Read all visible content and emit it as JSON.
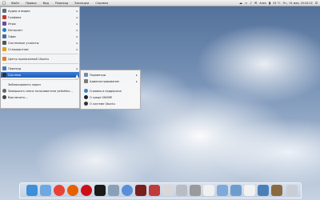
{
  "topbar": {
    "menus": [
      "Файл",
      "Правка",
      "Вид",
      "Переход",
      "Закладки",
      "Справка"
    ],
    "user": "Алек",
    "status": "25 °C",
    "datetime": "Пт., 31 мая, 20:43:22"
  },
  "main_menu": {
    "items": [
      {
        "label": "Аудио и видео",
        "icon": "audio-video-icon",
        "color": "#5b6f8a",
        "submenu": true
      },
      {
        "label": "Графика",
        "icon": "graphics-icon",
        "color": "#c0392b",
        "submenu": true
      },
      {
        "label": "Игры",
        "icon": "games-icon",
        "color": "#6b4aa0",
        "submenu": true
      },
      {
        "label": "Интернет",
        "icon": "internet-icon",
        "color": "#2b78c5",
        "submenu": true
      },
      {
        "label": "Офис",
        "icon": "office-icon",
        "color": "#3b6ea5",
        "submenu": true
      },
      {
        "label": "Системные утилиты",
        "icon": "system-tools-icon",
        "color": "#555555",
        "submenu": true
      },
      {
        "label": "Стандартные",
        "icon": "accessories-icon",
        "color": "#e0a020",
        "submenu": true
      },
      {
        "label": "Центр приложений Ubuntu",
        "icon": "ubuntu-software-center-icon",
        "color": "#d9822b",
        "submenu": false
      },
      {
        "label": "Переход",
        "icon": "places-icon",
        "color": "#4a76b8",
        "submenu": true
      },
      {
        "label": "Система",
        "icon": "system-icon",
        "color": "#333333",
        "submenu": true,
        "selected": true
      },
      {
        "label": "Заблокировать экран",
        "icon": "lock-screen-icon",
        "color": "#777777",
        "submenu": false
      },
      {
        "label": "Завершить сеанс пользователя yetishiku...",
        "icon": "logout-icon",
        "color": "#666666",
        "submenu": false
      },
      {
        "label": "Выключить...",
        "icon": "shutdown-icon",
        "color": "#444444",
        "submenu": false
      }
    ]
  },
  "submenu": {
    "items": [
      {
        "label": "Параметры",
        "icon": "preferences-icon",
        "color": "#6f8cad",
        "submenu": true
      },
      {
        "label": "Администрирование",
        "icon": "administration-icon",
        "color": "#7a7a7a",
        "submenu": true
      },
      {
        "label": "Справка и поддержка",
        "icon": "help-icon",
        "color": "#3b82c4",
        "submenu": false
      },
      {
        "label": "О среде GNOME",
        "icon": "gnome-icon",
        "color": "#222222",
        "submenu": false
      },
      {
        "label": "О системе Ubuntu",
        "icon": "apple-icon",
        "color": "#333333",
        "submenu": false
      }
    ]
  },
  "dock": {
    "items": [
      {
        "name": "finder-icon",
        "color": "#3c8fd8"
      },
      {
        "name": "app-store-icon",
        "color": "#6ea8e0"
      },
      {
        "name": "chrome-icon",
        "color": "#e94235"
      },
      {
        "name": "firefox-icon",
        "color": "#e66000"
      },
      {
        "name": "opera-icon",
        "color": "#cc0f16"
      },
      {
        "name": "terminal-icon",
        "color": "#1a1a1a"
      },
      {
        "name": "photos-icon",
        "color": "#8aa0b8"
      },
      {
        "name": "itunes-icon",
        "color": "#5a8fd8"
      },
      {
        "name": "dictionary-icon",
        "color": "#7a1e1e"
      },
      {
        "name": "photo-booth-icon",
        "color": "#c23b3b"
      },
      {
        "name": "preview-icon",
        "color": "#d8d8d8"
      },
      {
        "name": "scanner-icon",
        "color": "#b8bcc4"
      },
      {
        "name": "calculator-icon",
        "color": "#9a9a9a"
      },
      {
        "name": "text-editor-icon",
        "color": "#f0f0f0"
      },
      {
        "name": "folder-icon",
        "color": "#7fa9d9"
      },
      {
        "name": "folder-icon",
        "color": "#6f9ccf"
      },
      {
        "name": "mail-icon",
        "color": "#f2f2f2"
      },
      {
        "name": "pen-icon",
        "color": "#4c7fb8"
      },
      {
        "name": "gimp-icon",
        "color": "#8a6a40"
      },
      {
        "name": "trash-icon",
        "color": "#c9ced6"
      }
    ]
  }
}
